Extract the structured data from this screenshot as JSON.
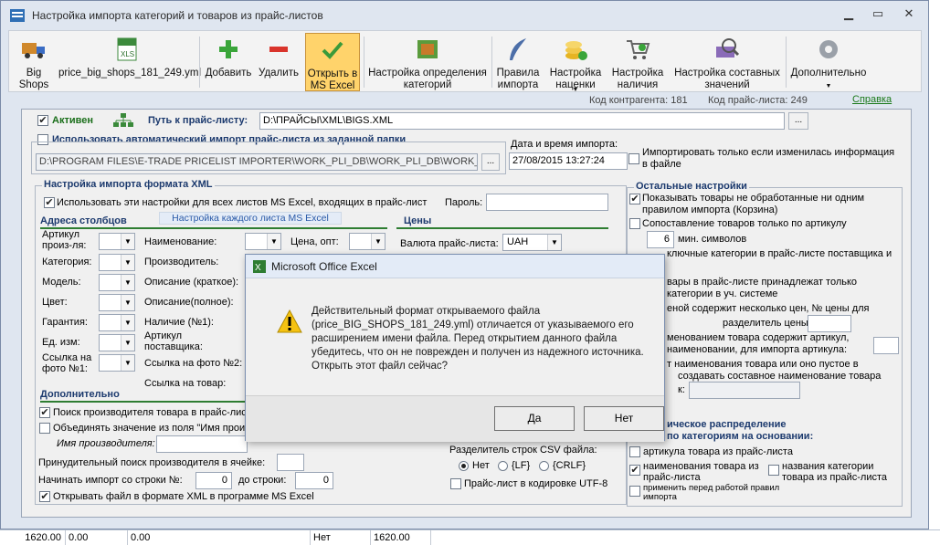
{
  "window": {
    "title": "Настройка импорта категорий и товаров из прайс-листов"
  },
  "toolbar": {
    "big_shops": "Big\nShops",
    "file": "price_big_shops_181_249.yml",
    "add": "Добавить",
    "delete": "Удалить",
    "open_excel": "Открыть в\nMS Excel",
    "category_rules": "Настройка определения\nкатегорий",
    "import_rules": "Правила\nимпорта",
    "markup": "Настройка\nнаценки",
    "availability": "Настройка\nналичия",
    "composite": "Настройка составных\nзначений",
    "more": "Дополнительно"
  },
  "info": {
    "contractor_code": "Код контрагента: 181",
    "pricelist_code": "Код прайс-листа: 249",
    "help": "Справка"
  },
  "general": {
    "active_label": "Активен",
    "path_label": "Путь к прайс-листу:",
    "path_value": "D:\\ПРАЙСЫ\\XML\\BIGS.XML",
    "browse": "...",
    "auto_import_label": "Использовать автоматический импорт прайс-листа из заданной папки",
    "auto_folder": "D:\\PROGRAM FILES\\E-TRADE PRICELIST IMPORTER\\WORK_PLI_DB\\WORK_PLI_DB\\WORK_PLI_DB",
    "datetime_label": "Дата и время импорта:",
    "datetime_value": "27/08/2015 13:27:24",
    "only_if_changed": "Импортировать только если изменилась информация в файле"
  },
  "xml": {
    "section": "Настройка импорта формата XML",
    "use_all_sheets": "Использовать эти настройки для всех листов MS Excel, входящих в прайс-лист",
    "password_label": "Пароль:",
    "columns_header": "Адреса столбцов",
    "each_sheet_link": "Настройка каждого листа MS Excel",
    "prices_header": "Цены",
    "col1": [
      "Артикул\nпроиз-ля:",
      "Категория:",
      "Модель:",
      "Цвет:",
      "Гарантия:",
      "Ед. изм:",
      "Ссылка на\nфото №1:"
    ],
    "col2": [
      "Наименование:",
      "Производитель:",
      "Описание (краткое):",
      "Описание(полное):",
      "Наличие (№1):",
      "Артикул\nпоставщика:",
      "Ссылка на фото №2:",
      "Ссылка на товар:"
    ],
    "price_opt_label": "Цена, опт:",
    "currency_label": "Валюта прайс-листа:",
    "currency_value": "UAH",
    "extra_header": "Дополнительно",
    "search_manufacturer": "Поиск производителя товара в прайс-листе",
    "merge_field": "Объединять значение из поля \"Имя произ",
    "manufacturer_name": "Имя производителя:",
    "primary_search": "Принудительный поиск производителя в ячейке:",
    "start_row_label": "Начинать импорт со строки №:",
    "start_row_value": "0",
    "to_row_label": "до строки:",
    "to_row_value": "0",
    "open_xml_excel": "Открывать файл в формате XML в программе MS Excel",
    "csv_sep_label": "Разделитель строк CSV файла:",
    "csv_none": "Нет",
    "csv_lf": "{LF}",
    "csv_crlf": "{CRLF}",
    "utf8": "Прайс-лист в кодировке UTF-8"
  },
  "other": {
    "section": "Остальные настройки",
    "show_unprocessed": "Показывать товары не обработанные ни одним правилом импорта (Корзина)",
    "match_article": "Сопоставление товаров только по артикулу",
    "min_chars_value": "6",
    "min_chars_label": "мин. символов",
    "excluded_cats": "ключные категории в прайс-листе поставщика и",
    "belongs_one": "вары в прайс-листе принадлежат только",
    "one_category": "категории в уч. системе",
    "several_prices": "еной содержит несколько цен, № цены для",
    "price_sep_label": "разделитель цены:",
    "name_contains_article": "менованием товара содержит артикул,",
    "name_for_article": "наименовании, для импорта артикула:",
    "name_empty": "т наименования товара или оно пустое в",
    "create_composite": "создавать составное наименование товара",
    "colon_short": "к:",
    "distribution_header": "ическое распределение\nпо категориям на основании:",
    "dist_article": "артикула товара из прайс-листа",
    "dist_name": "наименования товара из прайс-листа",
    "dist_cat_names": "названия категории товара из прайс-листа",
    "apply_rules": "применить перед работой правил импорта"
  },
  "dialog": {
    "title": "Microsoft Office Excel",
    "message": "Действительный формат открываемого файла (price_BIG_SHOPS_181_249.yml) отличается от указываемого его расширением имени файла. Перед открытием данного файла убедитесь, что он не поврежден и получен из надежного источника. Открыть этот файл сейчас?",
    "yes": "Да",
    "no": "Нет"
  },
  "bottom_grid": {
    "c1": "1620.00",
    "c2": "0.00",
    "c3": "0.00",
    "c4": "Нет",
    "c5": "1620.00"
  }
}
